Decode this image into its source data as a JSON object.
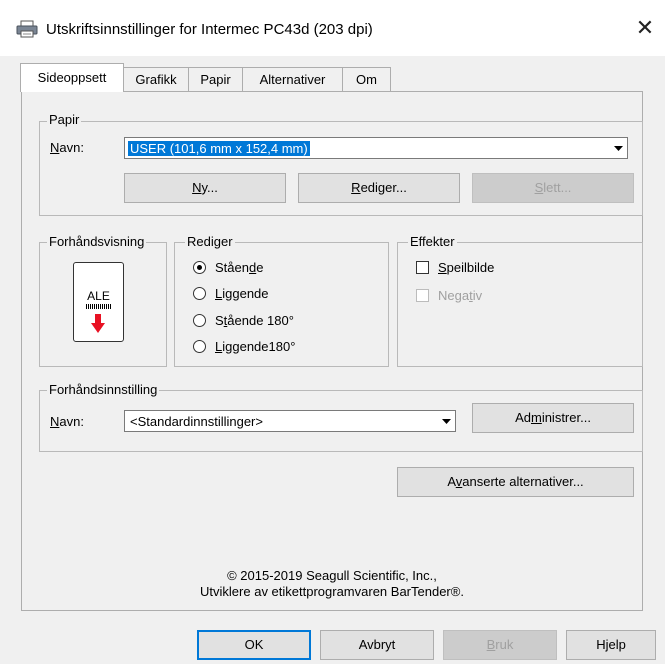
{
  "window": {
    "title": "Utskriftsinnstillinger for Intermec PC43d (203 dpi)",
    "close_glyph": "✕"
  },
  "tabs": [
    {
      "label": "Sideoppsett",
      "active": true
    },
    {
      "label": "Grafikk"
    },
    {
      "label": "Papir"
    },
    {
      "label": "Alternativer"
    },
    {
      "label": "Om"
    }
  ],
  "papir": {
    "group_label": "Papir",
    "name_label": "Navn:",
    "name_value": "USER (101,6 mm x 152,4 mm)",
    "btn_new": "Ny...",
    "btn_edit": "Rediger...",
    "btn_delete": "Slett..."
  },
  "preview": {
    "group_label": "Forhåndsvisning",
    "thumb_text": "ALE"
  },
  "rediger": {
    "group_label": "Rediger",
    "options": [
      "Stående",
      "Liggende",
      "Stående 180°",
      "Liggende180°"
    ],
    "selected": 0
  },
  "effekter": {
    "group_label": "Effekter",
    "mirror": "Speilbilde",
    "negative": "Negativ"
  },
  "preset": {
    "group_label": "Forhåndsinnstilling",
    "name_label": "Navn:",
    "name_value": "<Standardinnstillinger>",
    "btn_manage": "Administrer..."
  },
  "advanced_btn": "Avanserte alternativer...",
  "copyright": {
    "line1": "© 2015-2019 Seagull Scientific, Inc.,",
    "line2": "Utviklere av etikettprogramvaren BarTender®."
  },
  "footer": {
    "ok": "OK",
    "cancel": "Avbryt",
    "apply": "Bruk",
    "help": "Hjelp"
  },
  "colors": {
    "accent": "#0078d7",
    "arrow_red": "#e81123"
  }
}
